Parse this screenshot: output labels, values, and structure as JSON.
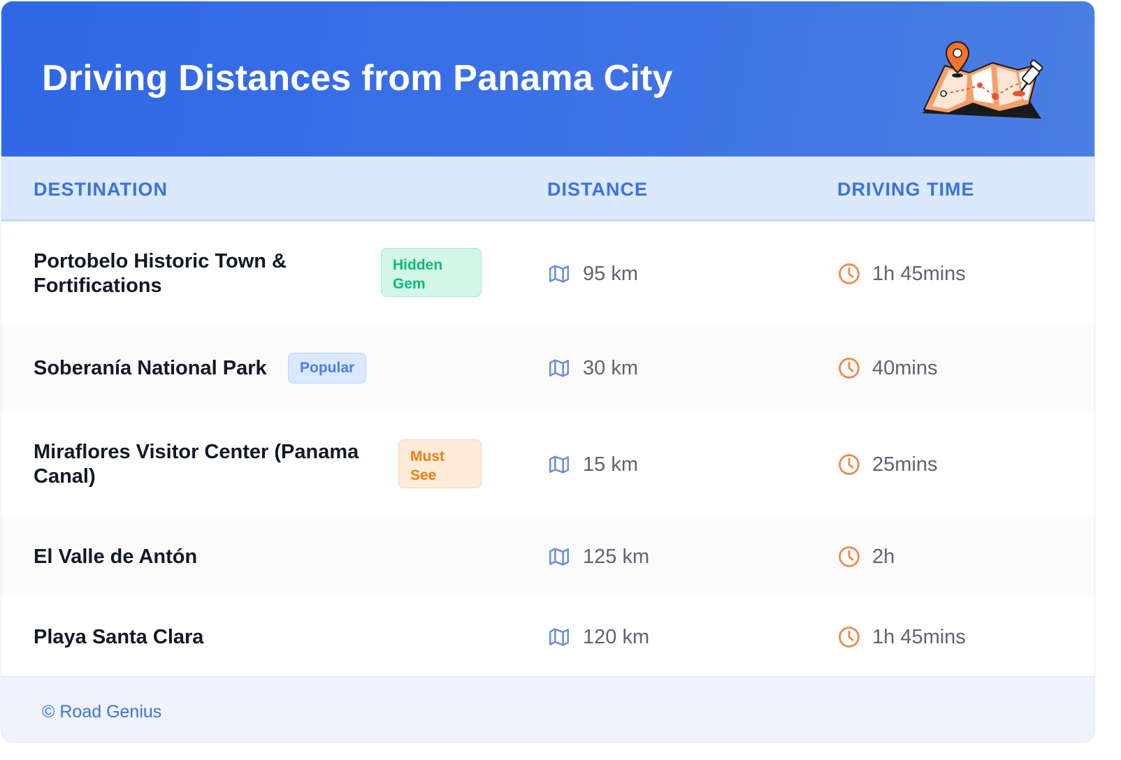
{
  "header": {
    "title": "Driving Distances from Panama City",
    "illustration": "folded-map-with-pin-icon"
  },
  "table": {
    "columns": [
      "DESTINATION",
      "DISTANCE",
      "DRIVING TIME"
    ],
    "rows": [
      {
        "destination": "Portobelo Historic Town & Fortifications",
        "badge": "Hidden Gem",
        "distance": "95 km",
        "time": "1h 45mins"
      },
      {
        "destination": "Soberanía National Park",
        "badge": "Popular",
        "distance": "30 km",
        "time": "40mins"
      },
      {
        "destination": "Miraflores Visitor Center (Panama Canal)",
        "badge": "Must See",
        "distance": "15 km",
        "time": "25mins"
      },
      {
        "destination": "El Valle de Antón",
        "badge": "",
        "distance": "125 km",
        "time": "2h"
      },
      {
        "destination": "Playa Santa Clara",
        "badge": "",
        "distance": "120 km",
        "time": "1h 45mins"
      }
    ]
  },
  "icons": {
    "distance": "map-icon",
    "time": "clock-icon"
  },
  "colors": {
    "header_gradient_start": "#2f67e6",
    "header_gradient_end": "#4a7ee3",
    "column_header_text": "#3b72de",
    "hidden_gem": "#10b981",
    "popular": "#4a7fe0",
    "must_see": "#f57c10",
    "clock": "#f08a4b",
    "map_icon": "#6b8fd6"
  },
  "footer": {
    "text": "© Road Genius"
  }
}
